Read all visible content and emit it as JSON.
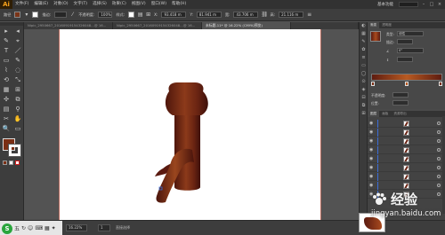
{
  "app": {
    "logo": "Ai",
    "menus": [
      "文件(F)",
      "编辑(E)",
      "对象(O)",
      "文字(T)",
      "选择(S)",
      "效果(C)",
      "视图(V)",
      "窗口(W)",
      "帮助(H)"
    ],
    "workspace": "基本功能",
    "window_controls": [
      "–",
      "□",
      "×"
    ]
  },
  "control_bar": {
    "selection_label": "路径",
    "stroke_label": "描边:",
    "stroke_weight": "",
    "opacity_label": "不透明度:",
    "opacity_value": "100%",
    "style_label": "样式:",
    "x_value": "93.418 m",
    "y_value": "81.941 m",
    "w_value": "43.706 m",
    "h_value": "21.116 m",
    "fill_color": "#7a3418"
  },
  "tabs": [
    {
      "label": "Nipic_2950667_20160919154326048...@ 16...",
      "active": false
    },
    {
      "label": "Nipic_2950667_20160919154326048...@ 16...",
      "active": false
    },
    {
      "label": "未标题-11* @ 16.22% (CMYK/预览)",
      "active": true
    },
    {
      "label": "",
      "active": false
    }
  ],
  "tools": [
    "▸",
    "◂",
    "✎",
    "⌖",
    "T",
    "／",
    "▭",
    "✎",
    "⌇",
    "◌",
    "⟲",
    "⤡",
    "▦",
    "⊞",
    "✣",
    "⧉",
    "▤",
    "⚲",
    "✂",
    "✋",
    "🔍",
    "▭"
  ],
  "swatches": {
    "fill": "#7a2e14",
    "mode_colors": [
      "#7a2e14",
      "#ffffff",
      "#d01e1e"
    ]
  },
  "gradient_panel": {
    "tabs": [
      "渐变",
      "透明度"
    ],
    "type_label": "类型:",
    "type_value": "线性",
    "stroke_label": "描边:",
    "angle_value": "0°",
    "opacity_label": "不透明度:",
    "location_label": "位置:"
  },
  "layers_panel": {
    "tabs": [
      "图层",
      "画板",
      "资源导出"
    ],
    "rows": 9
  },
  "status_bar": {
    "zoom": "16.22%",
    "page": "1",
    "tool_name": "直接选择"
  },
  "ime": {
    "logo": "S",
    "items": [
      "五",
      "↻",
      "☺",
      "⌨",
      "▦",
      "✦"
    ]
  },
  "watermark": {
    "brand": "经验",
    "url": "jingyan.baidu.com"
  }
}
